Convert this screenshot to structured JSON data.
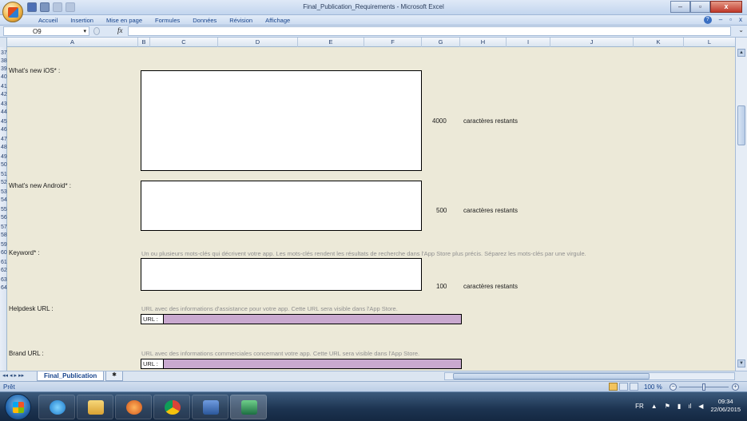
{
  "window": {
    "title": "Final_Publication_Requirements - Microsoft Excel",
    "minimize": "–",
    "maximize": "▫",
    "close": "x"
  },
  "ribbon": {
    "tabs": [
      "Accueil",
      "Insertion",
      "Mise en page",
      "Formules",
      "Données",
      "Révision",
      "Affichage"
    ],
    "right_controls": [
      "–",
      "▫",
      "x"
    ]
  },
  "formula_bar": {
    "name_box": "O9",
    "fx": "fx",
    "value": ""
  },
  "columns": [
    "A",
    "B",
    "C",
    "D",
    "E",
    "F",
    "G",
    "H",
    "I",
    "J",
    "K",
    "L"
  ],
  "rows": [
    "37",
    "38",
    "39",
    "40",
    "41",
    "42",
    "43",
    "44",
    "45",
    "46",
    "47",
    "48",
    "49",
    "50",
    "51",
    "52",
    "53",
    "54",
    "55",
    "56",
    "57",
    "58",
    "59",
    "60",
    "61",
    "62",
    "63",
    "64"
  ],
  "fields": {
    "whats_new_ios": {
      "label": "What's new iOS* :",
      "count": "4000",
      "remaining": "caractères restants"
    },
    "whats_new_android": {
      "label": "What's new Android* :",
      "count": "500",
      "remaining": "caractères restants"
    },
    "keyword": {
      "label": "Keyword* :",
      "hint": "Un ou plusieurs mots-clés qui décrivent votre app. Les mots-clés rendent les résultats de recherche dans l'App Store plus précis. Séparez les mots-clés par une virgule.",
      "count": "100",
      "remaining": "caractères restants"
    },
    "helpdesk_url": {
      "label": "Helpdesk URL :",
      "hint": "URL avec des informations d'assistance pour votre app. Cette URL sera visible dans l'App Store.",
      "url_label": "URL :"
    },
    "brand_url": {
      "label": "Brand URL :",
      "hint": "URL avec des informations commerciales concernant votre app. Cette URL sera visible dans l'App Store.",
      "url_label": "URL :"
    }
  },
  "sheet_tabs": {
    "active": "Final_Publication",
    "nav": [
      "◂◂",
      "◂",
      "▸",
      "▸▸"
    ]
  },
  "status": {
    "text": "Prêt",
    "zoom": "100 %",
    "zoom_level_percent": 100
  },
  "taskbar": {
    "language": "FR",
    "time": "09:34",
    "date": "22/06/2015",
    "apps": [
      "internet-explorer",
      "file-explorer",
      "media-player",
      "chrome",
      "word",
      "excel"
    ]
  },
  "colors": {
    "grid_bg": "#ece9d8",
    "url_field": "#c9a9cf",
    "hint_text": "#909090"
  }
}
